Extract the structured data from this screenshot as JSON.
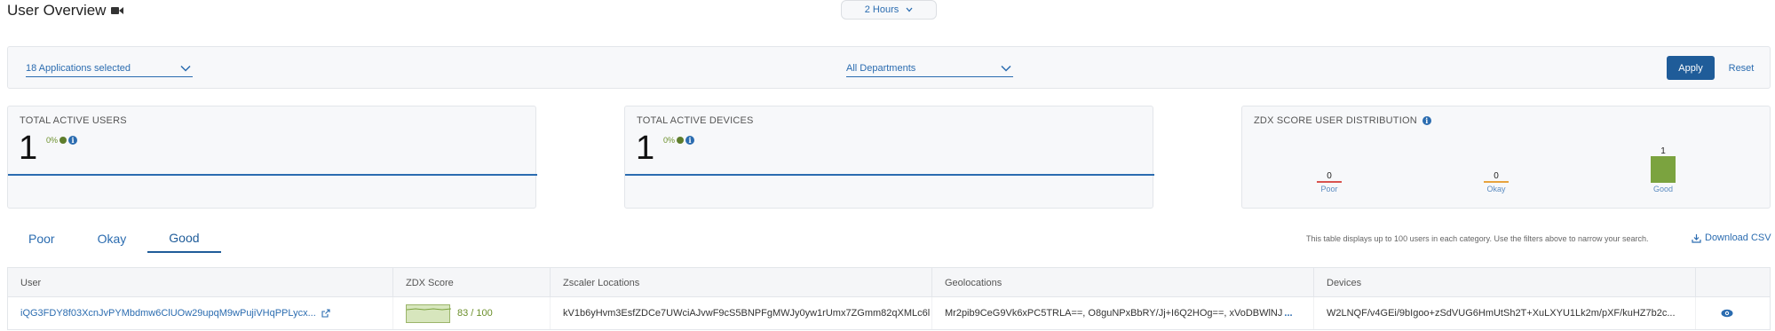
{
  "header": {
    "title": "User Overview",
    "title_icon": "video-camera-icon",
    "time_range": "2 Hours"
  },
  "filters": {
    "applications": "18 Applications selected",
    "departments": "All Departments",
    "apply_label": "Apply",
    "reset_label": "Reset"
  },
  "stats": {
    "active_users": {
      "title": "TOTAL ACTIVE USERS",
      "value": "1",
      "trend": "0%"
    },
    "active_devices": {
      "title": "TOTAL ACTIVE DEVICES",
      "value": "1",
      "trend": "0%"
    },
    "distribution": {
      "title": "ZDX SCORE USER DISTRIBUTION",
      "bars": [
        {
          "label": "Poor",
          "count": 0,
          "count_text": "0",
          "color": "#d9534f"
        },
        {
          "label": "Okay",
          "count": 0,
          "count_text": "0",
          "color": "#e8a33d"
        },
        {
          "label": "Good",
          "count": 1,
          "count_text": "1",
          "color": "#7ba33f"
        }
      ]
    }
  },
  "tabs": [
    {
      "label": "Poor",
      "active": false
    },
    {
      "label": "Okay",
      "active": false
    },
    {
      "label": "Good",
      "active": true
    }
  ],
  "table_note": "This table displays up to 100 users in each category. Use the filters above to narrow your search.",
  "download_label": "Download CSV",
  "table": {
    "columns": [
      "User",
      "ZDX Score",
      "Zscaler Locations",
      "Geolocations",
      "Devices"
    ],
    "rows": [
      {
        "user": "iQG3FDY8f03XcnJvPYMbdmw6ClUOw29upqM9wPujiVHqPPLycx...",
        "score": "83 / 100",
        "score_fraction": 0.83,
        "locations": "kV1b6yHvm3EsfZDCe7UWciAJvwF9cS5BNPFgMWJy0yw1rUmx7ZGmm82qXMLc6l",
        "geolocations": "Mr2pib9CeG9Vk6xPC5TRLA==, O8guNPxBbRY/Jj+I6Q2HOg==, xVoDBWlNJ",
        "devices": "W2LNQF/v4GEi/9bIgoo+zSdVUG6HmUtSh2T+XuLXYU1Lk2m/pXF/kuHZ7b2c..."
      }
    ]
  },
  "colors": {
    "accent": "#2b6cb0",
    "button": "#1f5c99",
    "good": "#7ba33f",
    "okay": "#e8a33d",
    "poor": "#d9534f"
  }
}
